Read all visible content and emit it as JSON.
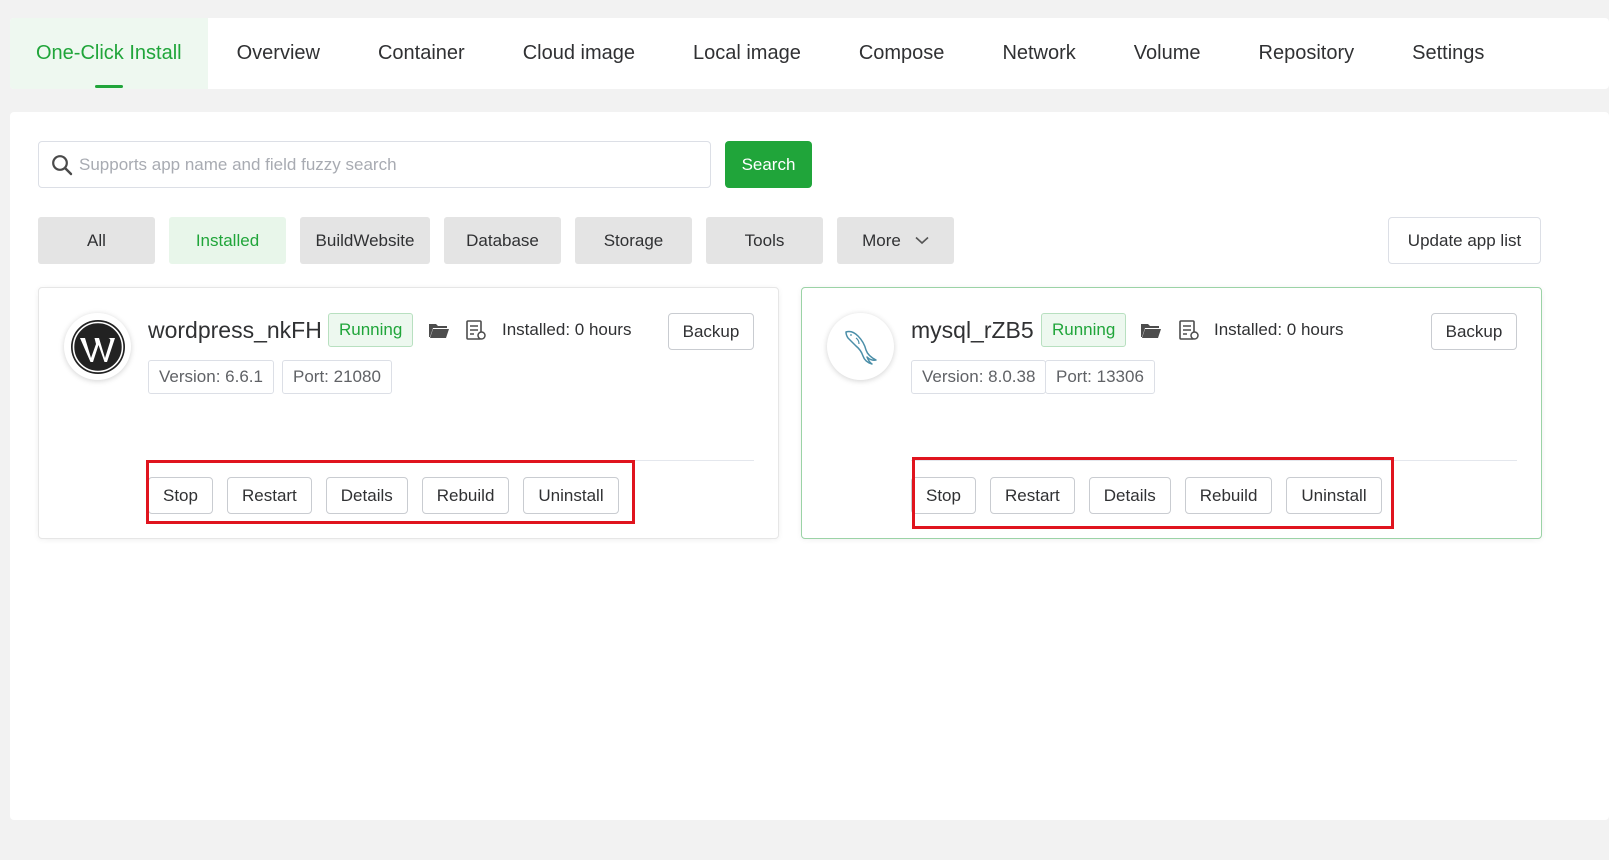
{
  "tabs": [
    {
      "label": "One-Click Install",
      "active": true
    },
    {
      "label": "Overview"
    },
    {
      "label": "Container"
    },
    {
      "label": "Cloud image"
    },
    {
      "label": "Local image"
    },
    {
      "label": "Compose"
    },
    {
      "label": "Network"
    },
    {
      "label": "Volume"
    },
    {
      "label": "Repository"
    },
    {
      "label": "Settings"
    }
  ],
  "search": {
    "placeholder": "Supports app name and field fuzzy search",
    "value": "",
    "button_label": "Search"
  },
  "filters": [
    {
      "label": "All"
    },
    {
      "label": "Installed",
      "active": true
    },
    {
      "label": "BuildWebsite"
    },
    {
      "label": "Database"
    },
    {
      "label": "Storage"
    },
    {
      "label": "Tools"
    },
    {
      "label": "More"
    }
  ],
  "update_app_list_label": "Update app list",
  "apps": [
    {
      "name": "wordpress_nkFH",
      "icon": "wordpress-logo-icon",
      "status": "Running",
      "installed": "Installed: 0 hours",
      "backup_label": "Backup",
      "version": "Version: 6.6.1",
      "port": "Port: 21080",
      "actions": [
        "Stop",
        "Restart",
        "Details",
        "Rebuild",
        "Uninstall"
      ]
    },
    {
      "name": "mysql_rZB5",
      "icon": "mysql-dolphin-icon",
      "status": "Running",
      "installed": "Installed: 0 hours",
      "backup_label": "Backup",
      "version": "Version: 8.0.38",
      "port": "Port: 13306",
      "actions": [
        "Stop",
        "Restart",
        "Details",
        "Rebuild",
        "Uninstall"
      ]
    }
  ],
  "colors": {
    "accent": "#20a53a",
    "highlight": "#e0141e"
  }
}
